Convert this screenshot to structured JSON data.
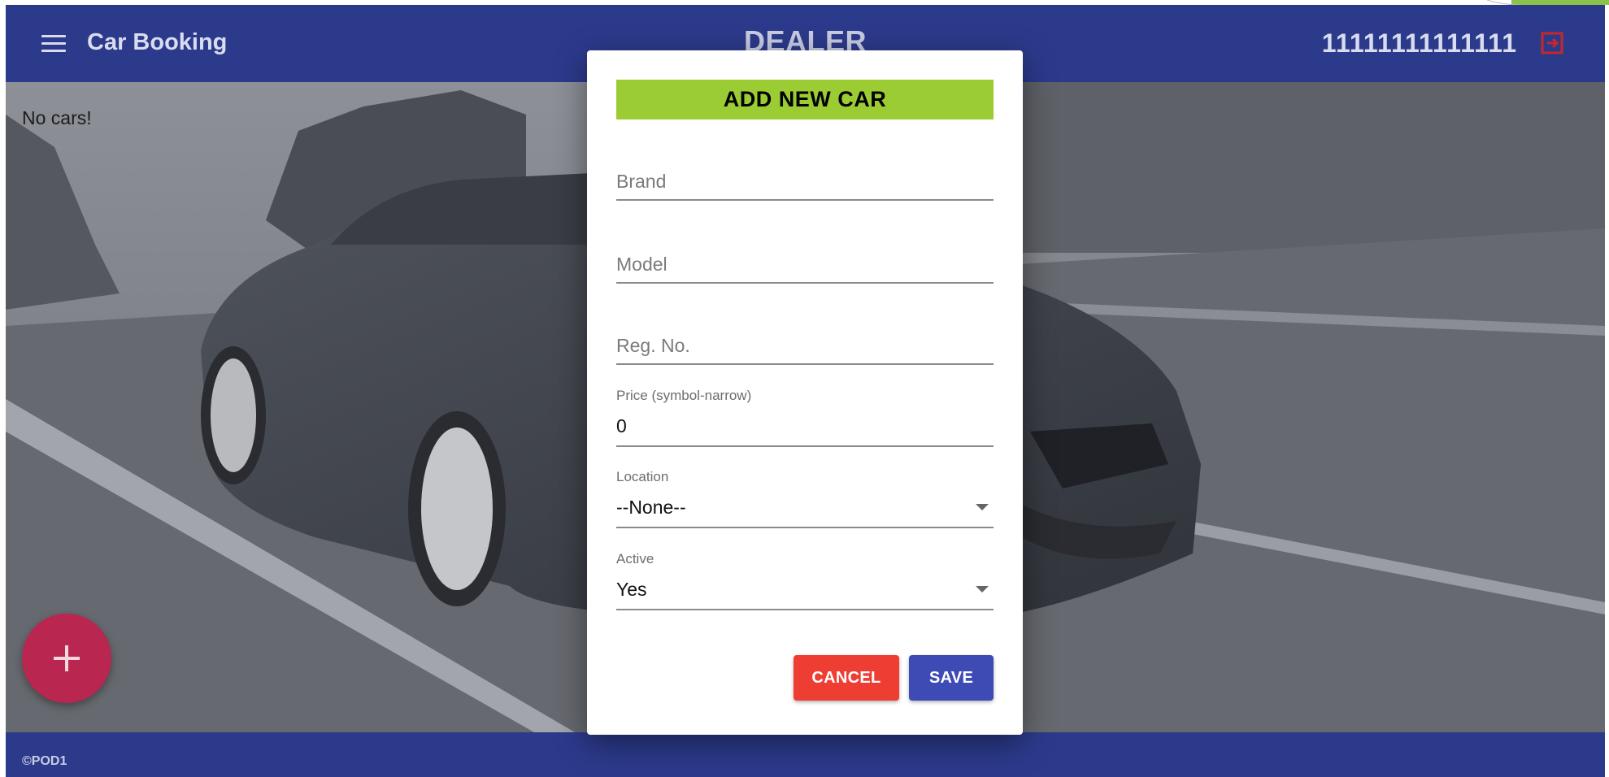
{
  "header": {
    "app_title": "Car Booking",
    "center_title": "DEALER",
    "user_id": "11111111111111",
    "menu_icon": "hamburger-menu-icon",
    "logout_icon": "logout-icon",
    "colors": {
      "bar": "#2c3a8c",
      "logout": "#c62828"
    }
  },
  "main": {
    "empty_message": "No cars!",
    "fab_icon": "plus-icon",
    "fab_color": "#b9264f"
  },
  "footer": {
    "copyright": "©POD1"
  },
  "modal": {
    "title": "ADD NEW CAR",
    "title_bg": "#9ccc33",
    "fields": {
      "brand": {
        "placeholder": "Brand"
      },
      "model": {
        "placeholder": "Model"
      },
      "reg_no": {
        "placeholder": "Reg. No."
      },
      "price": {
        "label": "Price (symbol-narrow)",
        "value": "0"
      },
      "location": {
        "label": "Location",
        "value": "--None--"
      },
      "active": {
        "label": "Active",
        "value": "Yes"
      }
    },
    "buttons": {
      "cancel": "CANCEL",
      "save": "SAVE"
    },
    "colors": {
      "cancel": "#ee3e33",
      "save": "#3e4bb5"
    }
  }
}
